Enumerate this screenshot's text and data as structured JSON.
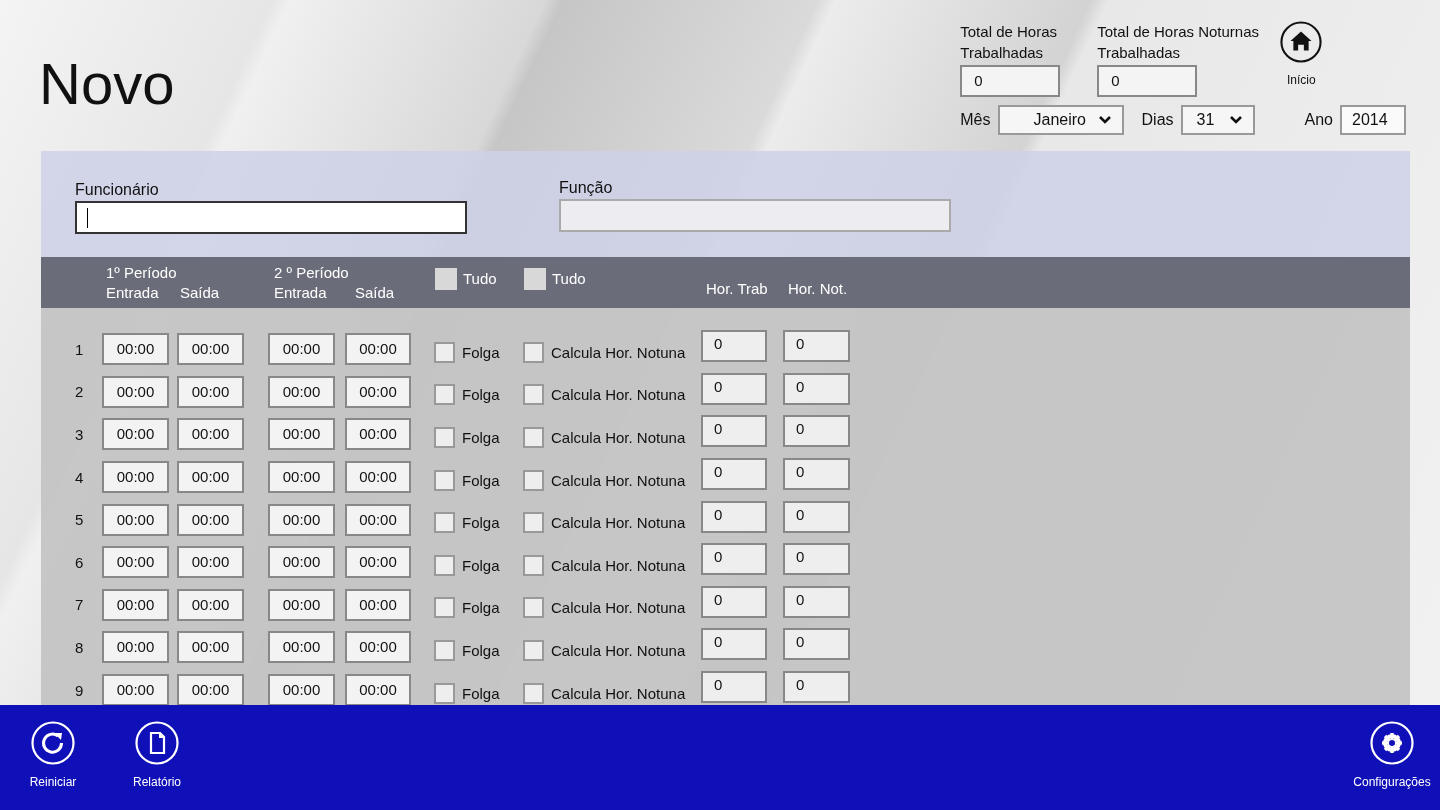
{
  "title": "Novo",
  "totals": [
    {
      "label": "Total de Horas Trabalhadas",
      "value": "0"
    },
    {
      "label": "Total de Horas Noturnas Trabalhadas",
      "value": "0"
    }
  ],
  "home_button": {
    "label": "Início"
  },
  "period": {
    "month": {
      "label": "Mês",
      "value": "Janeiro"
    },
    "days": {
      "label": "Dias",
      "value": "31"
    },
    "year": {
      "label": "Ano",
      "value": "2014"
    }
  },
  "employee": {
    "label": "Funcionário",
    "focused": true
  },
  "role": {
    "label": "Função",
    "disabled": true
  },
  "table_header": {
    "period_1": "1º Período",
    "period_2": "2 º Período",
    "entrada_1": "Entrada",
    "saida_1": "Saída",
    "entrada_2": "Entrada",
    "saida_2": "Saída",
    "select_all": [
      {
        "label": "Tudo",
        "checked": false
      },
      {
        "label": "Tudo",
        "checked": false
      }
    ],
    "hor_trab": "Hor. Trab",
    "hor_not": "Hor. Not."
  },
  "rows": [
    {
      "day": "1",
      "entrada_1": "00:00",
      "saida_1": "00:00",
      "entrada_2": "00:00",
      "saida_2": "00:00",
      "folga": {
        "label": "Folga",
        "checked": false
      },
      "calcula": {
        "label": "Calcula Hor. Notuna",
        "checked": false
      },
      "hor_trab": "0",
      "hor_not": "0"
    },
    {
      "day": "2",
      "entrada_1": "00:00",
      "saida_1": "00:00",
      "entrada_2": "00:00",
      "saida_2": "00:00",
      "folga": {
        "label": "Folga",
        "checked": false
      },
      "calcula": {
        "label": "Calcula Hor. Notuna",
        "checked": false
      },
      "hor_trab": "0",
      "hor_not": "0"
    },
    {
      "day": "3",
      "entrada_1": "00:00",
      "saida_1": "00:00",
      "entrada_2": "00:00",
      "saida_2": "00:00",
      "folga": {
        "label": "Folga",
        "checked": false
      },
      "calcula": {
        "label": "Calcula Hor. Notuna",
        "checked": false
      },
      "hor_trab": "0",
      "hor_not": "0"
    },
    {
      "day": "4",
      "entrada_1": "00:00",
      "saida_1": "00:00",
      "entrada_2": "00:00",
      "saida_2": "00:00",
      "folga": {
        "label": "Folga",
        "checked": false
      },
      "calcula": {
        "label": "Calcula Hor. Notuna",
        "checked": false
      },
      "hor_trab": "0",
      "hor_not": "0"
    },
    {
      "day": "5",
      "entrada_1": "00:00",
      "saida_1": "00:00",
      "entrada_2": "00:00",
      "saida_2": "00:00",
      "folga": {
        "label": "Folga",
        "checked": false
      },
      "calcula": {
        "label": "Calcula Hor. Notuna",
        "checked": false
      },
      "hor_trab": "0",
      "hor_not": "0"
    },
    {
      "day": "6",
      "entrada_1": "00:00",
      "saida_1": "00:00",
      "entrada_2": "00:00",
      "saida_2": "00:00",
      "folga": {
        "label": "Folga",
        "checked": false
      },
      "calcula": {
        "label": "Calcula Hor. Notuna",
        "checked": false
      },
      "hor_trab": "0",
      "hor_not": "0"
    },
    {
      "day": "7",
      "entrada_1": "00:00",
      "saida_1": "00:00",
      "entrada_2": "00:00",
      "saida_2": "00:00",
      "folga": {
        "label": "Folga",
        "checked": false
      },
      "calcula": {
        "label": "Calcula Hor. Notuna",
        "checked": false
      },
      "hor_trab": "0",
      "hor_not": "0"
    },
    {
      "day": "8",
      "entrada_1": "00:00",
      "saida_1": "00:00",
      "entrada_2": "00:00",
      "saida_2": "00:00",
      "folga": {
        "label": "Folga",
        "checked": false
      },
      "calcula": {
        "label": "Calcula Hor. Notuna",
        "checked": false
      },
      "hor_trab": "0",
      "hor_not": "0"
    },
    {
      "day": "9",
      "entrada_1": "00:00",
      "saida_1": "00:00",
      "entrada_2": "00:00",
      "saida_2": "00:00",
      "folga": {
        "label": "Folga",
        "checked": false
      },
      "calcula": {
        "label": "Calcula Hor. Notuna",
        "checked": false
      },
      "hor_trab": "0",
      "hor_not": "0"
    }
  ],
  "app_bar": {
    "left": [
      {
        "kind": "refresh",
        "label": "Reiniciar"
      },
      {
        "kind": "document",
        "label": "Relatório"
      }
    ],
    "right": [
      {
        "kind": "settings",
        "label": "Configurações"
      }
    ]
  }
}
